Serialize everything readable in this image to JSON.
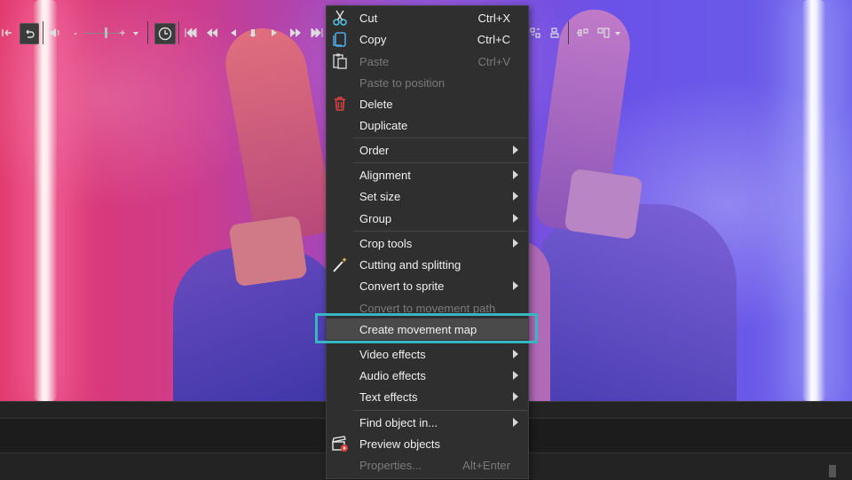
{
  "menu": {
    "items": [
      {
        "label": "Cut",
        "shortcut": "Ctrl+X"
      },
      {
        "label": "Copy",
        "shortcut": "Ctrl+C"
      },
      {
        "label": "Paste",
        "shortcut": "Ctrl+V"
      },
      {
        "label": "Paste to position"
      },
      {
        "label": "Delete"
      },
      {
        "label": "Duplicate"
      },
      {
        "label": "Order"
      },
      {
        "label": "Alignment"
      },
      {
        "label": "Set size"
      },
      {
        "label": "Group"
      },
      {
        "label": "Crop tools"
      },
      {
        "label": "Cutting and splitting"
      },
      {
        "label": "Convert to sprite"
      },
      {
        "label": "Convert to movement path"
      },
      {
        "label": "Create movement map"
      },
      {
        "label": "Video effects"
      },
      {
        "label": "Audio effects"
      },
      {
        "label": "Text effects"
      },
      {
        "label": "Find object in..."
      },
      {
        "label": "Preview objects"
      },
      {
        "label": "Properties...",
        "shortcut": "Alt+Enter"
      }
    ],
    "highlight_color": "#36b7c2"
  },
  "toolbar": {
    "zoom_minus": "-",
    "zoom_plus": "+"
  },
  "colors": {
    "menu_bg": "#2f2f2f",
    "toolbar_bg": "#232323"
  }
}
